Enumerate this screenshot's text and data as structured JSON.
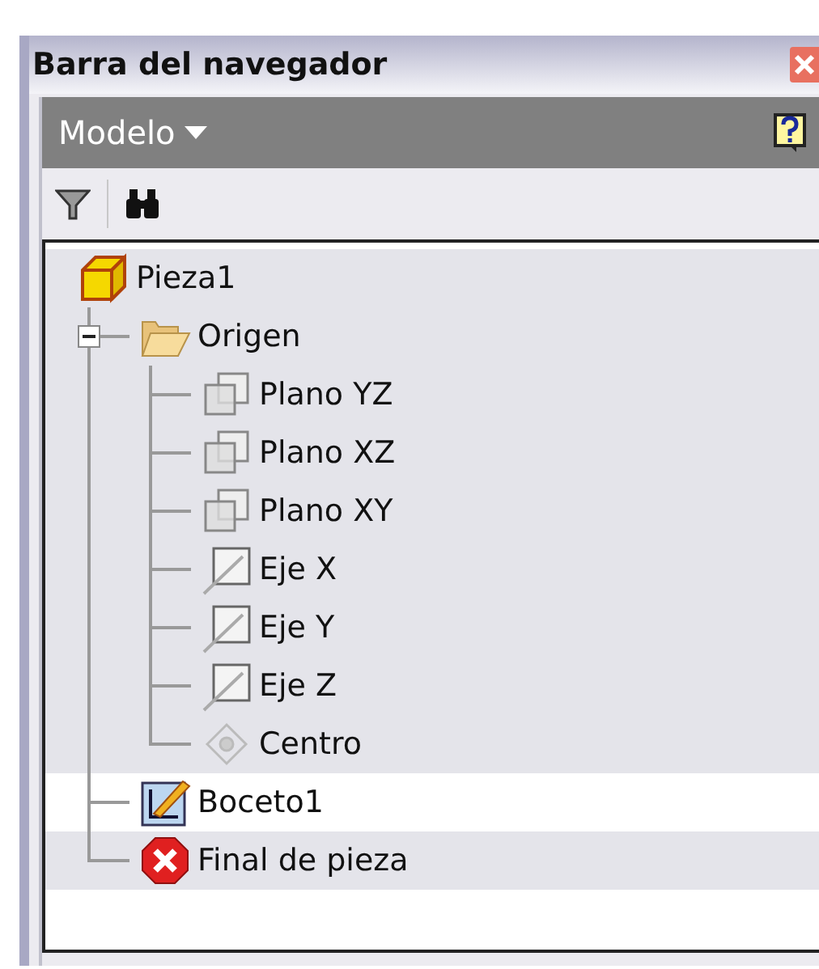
{
  "window": {
    "title": "Barra del navegador"
  },
  "header": {
    "label": "Modelo"
  },
  "tree": [
    {
      "label": "Pieza1",
      "kind": "part",
      "selected": false,
      "children": [
        {
          "label": "Origen",
          "kind": "folder",
          "selected": false,
          "expanded": true,
          "children": [
            {
              "label": "Plano YZ",
              "kind": "plane",
              "selected": false
            },
            {
              "label": "Plano XZ",
              "kind": "plane",
              "selected": false
            },
            {
              "label": "Plano XY",
              "kind": "plane",
              "selected": false
            },
            {
              "label": "Eje X",
              "kind": "axis",
              "selected": false
            },
            {
              "label": "Eje Y",
              "kind": "axis",
              "selected": false
            },
            {
              "label": "Eje Z",
              "kind": "axis",
              "selected": false
            },
            {
              "label": "Centro",
              "kind": "point",
              "selected": false
            }
          ]
        },
        {
          "label": "Boceto1",
          "kind": "sketch",
          "selected": true
        },
        {
          "label": "Final de pieza",
          "kind": "end",
          "selected": false
        }
      ]
    }
  ]
}
